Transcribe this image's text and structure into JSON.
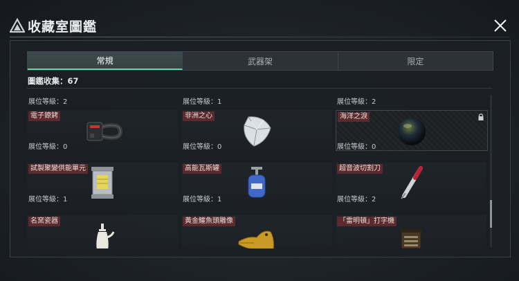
{
  "header": {
    "title": "收藏室圖鑑"
  },
  "tabs": [
    {
      "label": "常規",
      "active": true
    },
    {
      "label": "武器架",
      "active": false
    },
    {
      "label": "限定",
      "active": false
    }
  ],
  "collection": {
    "label": "圖鑑收集：67"
  },
  "top_row_levels": [
    "展位等級：2",
    "展位等級：1",
    "展位等級：2"
  ],
  "items": [
    {
      "name": "電子鐐銬",
      "icon": "shackle-icon",
      "level": "展位等級：0",
      "locked": false
    },
    {
      "name": "非洲之心",
      "icon": "diamond-icon",
      "level": "展位等級：0",
      "locked": false
    },
    {
      "name": "海洋之淚",
      "icon": "pearl-icon",
      "level": "展位等級：0",
      "locked": true
    },
    {
      "name": "試製聚變供能單元",
      "icon": "fusion-unit-icon",
      "level": "展位等級：1",
      "locked": false
    },
    {
      "name": "高能瓦斯罐",
      "icon": "gas-tank-icon",
      "level": "展位等級：1",
      "locked": false
    },
    {
      "name": "超音波切割刀",
      "icon": "cutter-icon",
      "level": "展位等級：2",
      "locked": false
    },
    {
      "name": "名窯瓷器",
      "icon": "porcelain-icon",
      "locked": false
    },
    {
      "name": "黃金鱷魚頭雕像",
      "icon": "gold-croc-icon",
      "locked": false
    },
    {
      "name": "「雷明頓」打字機",
      "icon": "typewriter-icon",
      "locked": false
    }
  ],
  "colors": {
    "accent": "#6ad0a8",
    "name_tag": "#5a2a2c"
  }
}
